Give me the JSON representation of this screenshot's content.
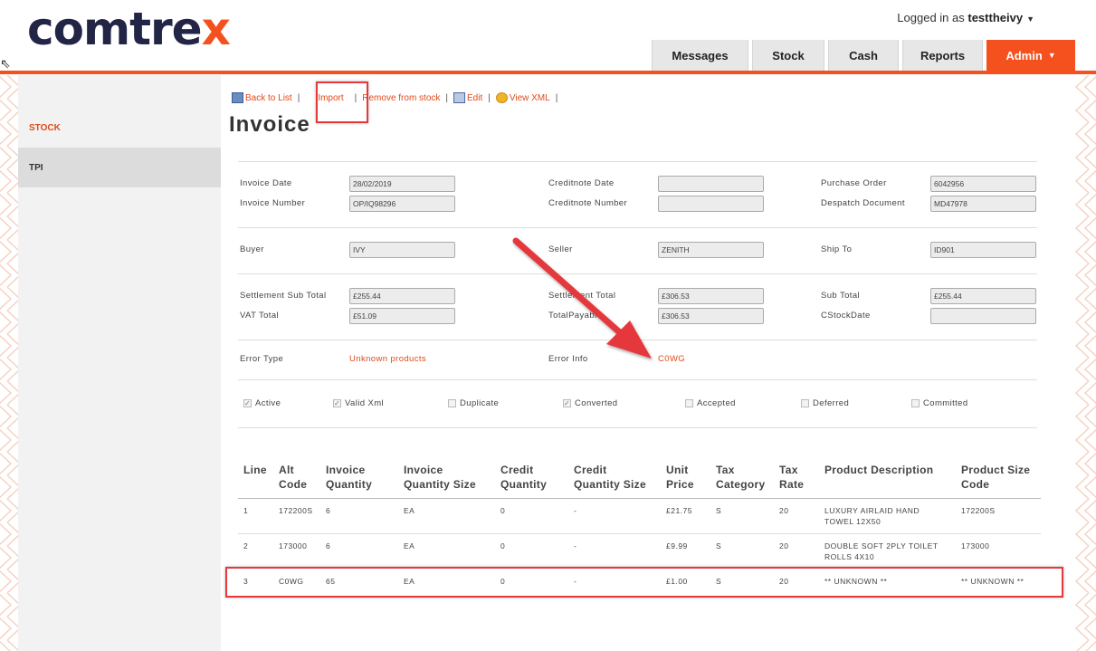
{
  "header": {
    "logo_main": "comtre",
    "logo_accent": "x",
    "login_prefix": "Logged in as",
    "username": "testtheivy"
  },
  "tabs": [
    {
      "label": "Messages"
    },
    {
      "label": "Stock"
    },
    {
      "label": "Cash"
    },
    {
      "label": "Reports"
    },
    {
      "label": "Admin"
    }
  ],
  "sidebar": {
    "items": [
      {
        "label": "STOCK"
      },
      {
        "label": "TPI"
      }
    ]
  },
  "toolbar": {
    "back": "Back to List",
    "import": "Import",
    "remove": "Remove from stock",
    "edit": "Edit",
    "view_xml": "View XML",
    "separator": "|"
  },
  "page_title": "Invoice",
  "fields": {
    "invoice_date": {
      "label": "Invoice Date",
      "value": "28/02/2019"
    },
    "invoice_number": {
      "label": "Invoice Number",
      "value": "OP/IQ98296"
    },
    "creditnote_date": {
      "label": "Creditnote Date",
      "value": ""
    },
    "creditnote_number": {
      "label": "Creditnote Number",
      "value": ""
    },
    "purchase_order": {
      "label": "Purchase Order",
      "value": "6042956"
    },
    "despatch_document": {
      "label": "Despatch Document",
      "value": "MD47978"
    },
    "buyer": {
      "label": "Buyer",
      "value": "IVY"
    },
    "seller": {
      "label": "Seller",
      "value": "ZENITH"
    },
    "ship_to": {
      "label": "Ship To",
      "value": "ID901"
    },
    "settlement_sub_total": {
      "label": "Settlement Sub Total",
      "value": "£255.44"
    },
    "settlement_total": {
      "label": "Settlement Total",
      "value": "£306.53"
    },
    "sub_total": {
      "label": "Sub Total",
      "value": "£255.44"
    },
    "vat_total": {
      "label": "VAT Total",
      "value": "£51.09"
    },
    "total_payable": {
      "label": "TotalPayable",
      "value": "£306.53"
    },
    "cstockdate": {
      "label": "CStockDate",
      "value": ""
    },
    "error_type": {
      "label": "Error Type",
      "value": "Unknown products"
    },
    "error_info": {
      "label": "Error Info",
      "value": "C0WG"
    }
  },
  "checkboxes": [
    {
      "label": "Active",
      "checked": true
    },
    {
      "label": "Valid Xml",
      "checked": true
    },
    {
      "label": "Duplicate",
      "checked": false
    },
    {
      "label": "Converted",
      "checked": true
    },
    {
      "label": "Accepted",
      "checked": false
    },
    {
      "label": "Deferred",
      "checked": false
    },
    {
      "label": "Committed",
      "checked": false
    }
  ],
  "table": {
    "headers": [
      "Line",
      "Alt Code",
      "Invoice Quantity",
      "Invoice Quantity Size",
      "Credit Quantity",
      "Credit Quantity Size",
      "Unit Price",
      "Tax Category",
      "Tax Rate",
      "Product Description",
      "Product Size Code"
    ],
    "rows": [
      [
        "1",
        "172200S",
        "6",
        "EA",
        "0",
        "-",
        "£21.75",
        "S",
        "20",
        "LUXURY AIRLAID HAND TOWEL 12X50",
        "172200S"
      ],
      [
        "2",
        "173000",
        "6",
        "EA",
        "0",
        "-",
        "£9.99",
        "S",
        "20",
        "DOUBLE SOFT 2PLY TOILET ROLLS 4X10",
        "173000"
      ],
      [
        "3",
        "C0WG",
        "65",
        "EA",
        "0",
        "-",
        "£1.00",
        "S",
        "20",
        "** UNKNOWN **",
        "** UNKNOWN **"
      ]
    ]
  },
  "colors": {
    "accent": "#f4511e",
    "annotation": "#e5393c",
    "brand_dark": "#222546"
  }
}
